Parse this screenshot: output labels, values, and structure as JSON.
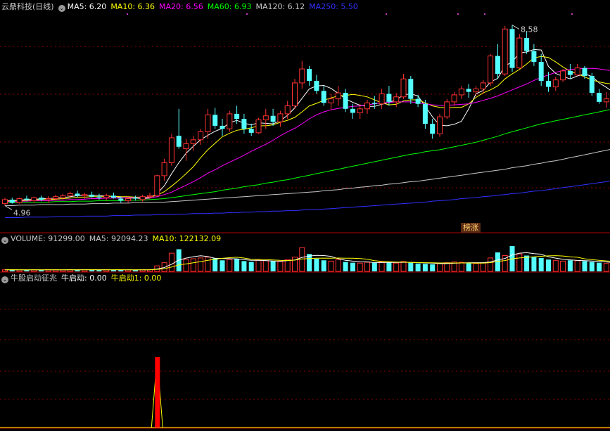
{
  "main": {
    "title": "云鼎科技(日线)",
    "toggle_icon": "circle-chevron-icon",
    "indicators": [
      {
        "label": "MA5: 6.20",
        "color": "#ffffff"
      },
      {
        "label": "MA10: 6.36",
        "color": "#ffff00"
      },
      {
        "label": "MA20: 6.56",
        "color": "#ff00ff"
      },
      {
        "label": "MA60: 6.93",
        "color": "#00ff00"
      },
      {
        "label": "MA120: 6.12",
        "color": "#c8c8c8"
      },
      {
        "label": "MA250: 5.50",
        "color": "#3030ff"
      }
    ],
    "high_label": "8.58",
    "low_label": "4.96",
    "badge": "榜涨"
  },
  "volume": {
    "labels": [
      {
        "label": "VOLUME: 91299.00",
        "color": "#c8c8c8"
      },
      {
        "label": "MA5: 92094.23",
        "color": "#c8c8c8"
      },
      {
        "label": "MA10: 122132.09",
        "color": "#ffff00"
      }
    ]
  },
  "indicator": {
    "labels": [
      {
        "label": "牛股启动征兆",
        "color": "#c8c8c8"
      },
      {
        "label": "牛启动: 0.00",
        "color": "#ffffff"
      },
      {
        "label": "牛启动1: 0.00",
        "color": "#ffff00"
      }
    ]
  },
  "colors": {
    "up": "#ff3232",
    "down": "#54ffff",
    "grid": "#8b0000",
    "frame": "#b00000"
  },
  "chart_data": {
    "type": "candlestick",
    "price_range": [
      4.6,
      8.8
    ],
    "ohlc": [
      [
        5.0,
        5.12,
        4.96,
        5.08
      ],
      [
        5.08,
        5.12,
        5.0,
        5.02
      ],
      [
        5.02,
        5.12,
        5.0,
        5.1
      ],
      [
        5.1,
        5.16,
        5.05,
        5.08
      ],
      [
        5.06,
        5.14,
        5.02,
        5.12
      ],
      [
        5.12,
        5.16,
        5.05,
        5.08
      ],
      [
        5.08,
        5.15,
        5.02,
        5.1
      ],
      [
        5.1,
        5.18,
        5.06,
        5.14
      ],
      [
        5.12,
        5.2,
        5.08,
        5.16
      ],
      [
        5.16,
        5.24,
        5.12,
        5.2
      ],
      [
        5.2,
        5.26,
        5.12,
        5.16
      ],
      [
        5.16,
        5.22,
        5.1,
        5.18
      ],
      [
        5.18,
        5.24,
        5.12,
        5.14
      ],
      [
        5.14,
        5.2,
        5.08,
        5.12
      ],
      [
        5.12,
        5.2,
        5.06,
        5.16
      ],
      [
        5.16,
        5.22,
        5.1,
        5.12
      ],
      [
        5.1,
        5.14,
        5.02,
        5.06
      ],
      [
        5.06,
        5.14,
        5.02,
        5.1
      ],
      [
        5.12,
        5.16,
        5.06,
        5.1
      ],
      [
        5.08,
        5.18,
        5.04,
        5.14
      ],
      [
        5.14,
        5.22,
        5.1,
        5.16
      ],
      [
        5.16,
        5.58,
        5.14,
        5.56
      ],
      [
        5.56,
        5.9,
        5.46,
        5.82
      ],
      [
        5.82,
        6.4,
        5.76,
        6.32
      ],
      [
        6.36,
        6.9,
        6.1,
        6.14
      ],
      [
        6.1,
        6.3,
        5.86,
        6.2
      ],
      [
        6.2,
        6.36,
        6.06,
        6.28
      ],
      [
        6.28,
        6.5,
        6.18,
        6.44
      ],
      [
        6.44,
        6.9,
        6.3,
        6.78
      ],
      [
        6.78,
        6.92,
        6.5,
        6.56
      ],
      [
        6.56,
        6.7,
        6.36,
        6.5
      ],
      [
        6.5,
        6.86,
        6.44,
        6.8
      ],
      [
        6.8,
        6.96,
        6.6,
        6.7
      ],
      [
        6.7,
        6.8,
        6.4,
        6.5
      ],
      [
        6.5,
        6.6,
        6.36,
        6.42
      ],
      [
        6.42,
        6.72,
        6.4,
        6.68
      ],
      [
        6.68,
        6.9,
        6.5,
        6.76
      ],
      [
        6.76,
        6.9,
        6.56,
        6.64
      ],
      [
        6.64,
        6.86,
        6.54,
        6.8
      ],
      [
        6.8,
        7.06,
        6.7,
        6.96
      ],
      [
        6.96,
        7.5,
        6.9,
        7.42
      ],
      [
        7.42,
        7.86,
        7.3,
        7.7
      ],
      [
        7.7,
        7.76,
        7.36,
        7.46
      ],
      [
        7.46,
        7.58,
        7.2,
        7.26
      ],
      [
        7.26,
        7.36,
        6.96,
        7.02
      ],
      [
        7.02,
        7.2,
        6.88,
        7.1
      ],
      [
        7.1,
        7.36,
        6.96,
        7.22
      ],
      [
        7.22,
        7.3,
        6.84,
        6.9
      ],
      [
        6.9,
        7.0,
        6.7,
        6.82
      ],
      [
        6.82,
        7.0,
        6.7,
        6.9
      ],
      [
        6.9,
        7.08,
        6.8,
        7.02
      ],
      [
        7.02,
        7.16,
        6.9,
        7.0
      ],
      [
        7.0,
        7.3,
        6.9,
        7.2
      ],
      [
        7.2,
        7.36,
        6.96,
        7.04
      ],
      [
        7.04,
        7.22,
        6.94,
        7.14
      ],
      [
        7.14,
        7.6,
        7.1,
        7.5
      ],
      [
        7.5,
        7.56,
        7.0,
        7.1
      ],
      [
        7.1,
        7.18,
        6.94,
        7.0
      ],
      [
        7.0,
        7.08,
        6.5,
        6.6
      ],
      [
        6.6,
        6.7,
        6.3,
        6.4
      ],
      [
        6.4,
        6.8,
        6.34,
        6.74
      ],
      [
        6.74,
        7.1,
        6.7,
        7.04
      ],
      [
        7.04,
        7.24,
        6.96,
        7.18
      ],
      [
        7.18,
        7.36,
        7.1,
        7.3
      ],
      [
        7.3,
        7.4,
        7.12,
        7.24
      ],
      [
        7.24,
        7.36,
        7.16,
        7.3
      ],
      [
        7.3,
        7.48,
        7.2,
        7.42
      ],
      [
        7.42,
        8.0,
        7.36,
        7.96
      ],
      [
        7.96,
        8.2,
        7.5,
        7.6
      ],
      [
        7.6,
        8.56,
        7.56,
        8.5
      ],
      [
        8.5,
        8.58,
        7.64,
        7.72
      ],
      [
        7.72,
        8.4,
        7.7,
        8.32
      ],
      [
        8.32,
        8.46,
        8.0,
        8.06
      ],
      [
        8.06,
        8.2,
        7.76,
        7.84
      ],
      [
        7.84,
        8.0,
        7.36,
        7.46
      ],
      [
        7.46,
        7.64,
        7.24,
        7.34
      ],
      [
        7.34,
        7.54,
        7.26,
        7.48
      ],
      [
        7.48,
        7.7,
        7.44,
        7.66
      ],
      [
        7.66,
        7.8,
        7.5,
        7.58
      ],
      [
        7.58,
        7.8,
        7.56,
        7.72
      ],
      [
        7.72,
        7.76,
        7.5,
        7.56
      ],
      [
        7.56,
        7.62,
        7.16,
        7.22
      ],
      [
        7.22,
        7.3,
        7.0,
        7.04
      ],
      [
        7.04,
        7.24,
        6.92,
        7.1
      ],
      [
        7.1,
        7.28,
        6.98,
        7.2
      ]
    ],
    "ma_lines": {
      "MA5": [
        5.06,
        5.06,
        5.07,
        5.08,
        5.08,
        5.1,
        5.1,
        5.11,
        5.12,
        5.14,
        5.16,
        5.17,
        5.17,
        5.16,
        5.15,
        5.15,
        5.12,
        5.11,
        5.11,
        5.1,
        5.11,
        5.2,
        5.36,
        5.6,
        5.82,
        6.01,
        6.15,
        6.28,
        6.37,
        6.45,
        6.51,
        6.62,
        6.67,
        6.61,
        6.58,
        6.62,
        6.61,
        6.6,
        6.66,
        6.77,
        6.92,
        7.11,
        7.3,
        7.36,
        7.37,
        7.31,
        7.21,
        7.1,
        7.03,
        6.97,
        6.95,
        6.95,
        6.99,
        7.03,
        7.08,
        7.18,
        7.2,
        7.16,
        6.95,
        6.74,
        6.57,
        6.56,
        6.59,
        6.65,
        6.9,
        7.2,
        7.27,
        7.44,
        7.51,
        7.76,
        7.84,
        8.02,
        8.04,
        8.09,
        8.08,
        7.75,
        7.61,
        7.55,
        7.5,
        7.56,
        7.6,
        7.55,
        7.42,
        7.33,
        7.23
      ],
      "MA10": [
        5.05,
        5.05,
        5.06,
        5.07,
        5.07,
        5.08,
        5.08,
        5.09,
        5.1,
        5.11,
        5.13,
        5.13,
        5.14,
        5.14,
        5.14,
        5.15,
        5.14,
        5.14,
        5.13,
        5.13,
        5.13,
        5.17,
        5.24,
        5.35,
        5.47,
        5.6,
        5.74,
        5.92,
        6.08,
        6.21,
        6.34,
        6.41,
        6.47,
        6.49,
        6.52,
        6.56,
        6.56,
        6.58,
        6.63,
        6.67,
        6.73,
        6.84,
        6.96,
        7.01,
        7.07,
        7.12,
        7.16,
        7.17,
        7.19,
        7.17,
        7.14,
        7.08,
        7.02,
        6.98,
        6.99,
        7.06,
        7.08,
        7.08,
        7.02,
        6.96,
        6.93,
        6.92,
        6.93,
        6.93,
        7.0,
        7.13,
        7.22,
        7.28,
        7.36,
        7.5,
        7.6,
        7.69,
        7.8,
        7.92,
        7.95,
        7.93,
        7.84,
        7.74,
        7.65,
        7.6,
        7.54,
        7.48,
        7.44,
        7.41,
        7.4
      ],
      "MA20": [
        5.04,
        5.04,
        5.05,
        5.05,
        5.06,
        5.06,
        5.06,
        5.07,
        5.07,
        5.08,
        5.08,
        5.09,
        5.1,
        5.1,
        5.11,
        5.11,
        5.11,
        5.12,
        5.12,
        5.12,
        5.12,
        5.14,
        5.18,
        5.23,
        5.3,
        5.37,
        5.44,
        5.52,
        5.61,
        5.68,
        5.76,
        5.83,
        5.9,
        5.97,
        6.05,
        6.12,
        6.19,
        6.27,
        6.36,
        6.44,
        6.51,
        6.6,
        6.7,
        6.78,
        6.84,
        6.88,
        6.91,
        6.93,
        6.95,
        6.96,
        6.98,
        7.0,
        7.02,
        7.03,
        7.04,
        7.04,
        7.04,
        7.02,
        7.0,
        6.98,
        6.97,
        6.97,
        6.98,
        6.99,
        7.0,
        7.03,
        7.07,
        7.11,
        7.16,
        7.22,
        7.28,
        7.34,
        7.4,
        7.47,
        7.53,
        7.58,
        7.63,
        7.67,
        7.69,
        7.7,
        7.71,
        7.71,
        7.7,
        7.68,
        7.66
      ],
      "MA60": [
        5.02,
        5.02,
        5.02,
        5.03,
        5.03,
        5.03,
        5.03,
        5.04,
        5.04,
        5.04,
        5.05,
        5.05,
        5.05,
        5.06,
        5.06,
        5.06,
        5.06,
        5.07,
        5.07,
        5.07,
        5.08,
        5.09,
        5.1,
        5.12,
        5.14,
        5.16,
        5.18,
        5.2,
        5.22,
        5.24,
        5.27,
        5.29,
        5.31,
        5.34,
        5.36,
        5.38,
        5.41,
        5.43,
        5.46,
        5.48,
        5.51,
        5.54,
        5.57,
        5.6,
        5.63,
        5.66,
        5.69,
        5.72,
        5.75,
        5.78,
        5.81,
        5.84,
        5.87,
        5.9,
        5.93,
        5.96,
        5.99,
        6.01,
        6.04,
        6.06,
        6.08,
        6.11,
        6.14,
        6.17,
        6.2,
        6.23,
        6.27,
        6.31,
        6.35,
        6.4,
        6.44,
        6.48,
        6.52,
        6.56,
        6.6,
        6.63,
        6.66,
        6.69,
        6.72,
        6.75,
        6.78,
        6.81,
        6.84,
        6.87,
        6.9
      ],
      "MA120": [
        4.96,
        4.96,
        4.97,
        4.97,
        4.97,
        4.98,
        4.98,
        4.98,
        4.98,
        4.99,
        4.99,
        4.99,
        5.0,
        5.0,
        5.0,
        5.01,
        5.01,
        5.01,
        5.02,
        5.02,
        5.02,
        5.03,
        5.03,
        5.04,
        5.05,
        5.06,
        5.07,
        5.08,
        5.09,
        5.1,
        5.11,
        5.12,
        5.13,
        5.14,
        5.15,
        5.16,
        5.17,
        5.18,
        5.19,
        5.2,
        5.21,
        5.22,
        5.23,
        5.24,
        5.26,
        5.27,
        5.28,
        5.3,
        5.31,
        5.33,
        5.34,
        5.36,
        5.37,
        5.39,
        5.4,
        5.42,
        5.44,
        5.45,
        5.47,
        5.49,
        5.51,
        5.53,
        5.55,
        5.57,
        5.59,
        5.61,
        5.63,
        5.65,
        5.67,
        5.69,
        5.72,
        5.74,
        5.76,
        5.79,
        5.81,
        5.84,
        5.86,
        5.89,
        5.92,
        5.95,
        5.98,
        6.01,
        6.04,
        6.07,
        6.1
      ],
      "MA250": [
        4.72,
        4.72,
        4.72,
        4.73,
        4.73,
        4.73,
        4.73,
        4.74,
        4.74,
        4.74,
        4.74,
        4.75,
        4.75,
        4.75,
        4.75,
        4.76,
        4.76,
        4.76,
        4.77,
        4.77,
        4.77,
        4.78,
        4.78,
        4.78,
        4.79,
        4.79,
        4.8,
        4.8,
        4.8,
        4.81,
        4.81,
        4.82,
        4.82,
        4.83,
        4.83,
        4.84,
        4.84,
        4.85,
        4.85,
        4.86,
        4.86,
        4.87,
        4.88,
        4.88,
        4.89,
        4.9,
        4.91,
        4.92,
        4.93,
        4.94,
        4.95,
        4.96,
        4.97,
        4.98,
        4.99,
        5.0,
        5.01,
        5.02,
        5.03,
        5.05,
        5.06,
        5.07,
        5.08,
        5.1,
        5.11,
        5.12,
        5.14,
        5.15,
        5.17,
        5.18,
        5.2,
        5.21,
        5.23,
        5.25,
        5.26,
        5.28,
        5.3,
        5.32,
        5.34,
        5.36,
        5.38,
        5.4,
        5.42,
        5.44,
        5.47
      ]
    },
    "volume": [
      20,
      22,
      18,
      21,
      20,
      19,
      22,
      21,
      20,
      23,
      22,
      21,
      20,
      19,
      21,
      22,
      20,
      19,
      21,
      20,
      22,
      70,
      110,
      230,
      280,
      150,
      160,
      170,
      180,
      165,
      140,
      150,
      160,
      130,
      120,
      140,
      135,
      130,
      125,
      150,
      180,
      300,
      220,
      160,
      140,
      130,
      150,
      120,
      110,
      105,
      115,
      110,
      120,
      115,
      105,
      125,
      110,
      100,
      95,
      90,
      100,
      110,
      120,
      115,
      105,
      100,
      110,
      170,
      240,
      200,
      320,
      220,
      200,
      180,
      170,
      150,
      140,
      130,
      140,
      135,
      130,
      120,
      110,
      100,
      95
    ],
    "signal": {
      "index": 21,
      "value": 1
    }
  }
}
